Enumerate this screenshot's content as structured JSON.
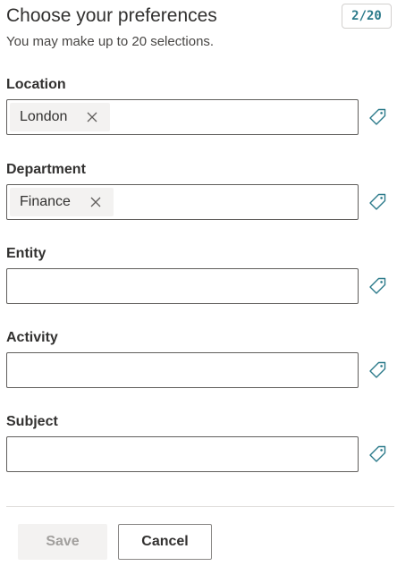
{
  "header": {
    "title": "Choose your preferences",
    "subtitle": "You may make up to 20 selections.",
    "selection_count": "2/20"
  },
  "fields": [
    {
      "label": "Location",
      "chips": [
        "London"
      ],
      "value": ""
    },
    {
      "label": "Department",
      "chips": [
        "Finance"
      ],
      "value": ""
    },
    {
      "label": "Entity",
      "chips": [],
      "value": ""
    },
    {
      "label": "Activity",
      "chips": [],
      "value": ""
    },
    {
      "label": "Subject",
      "chips": [],
      "value": ""
    }
  ],
  "icons": {
    "chip_remove": "close-icon",
    "field_action": "tag-icon"
  },
  "footer": {
    "save_label": "Save",
    "save_disabled": true,
    "cancel_label": "Cancel"
  },
  "colors": {
    "accent": "#2b7a8a",
    "chip_background": "#f3f2f1",
    "border": "#605e5c",
    "disabled_text": "#a19f9d"
  }
}
